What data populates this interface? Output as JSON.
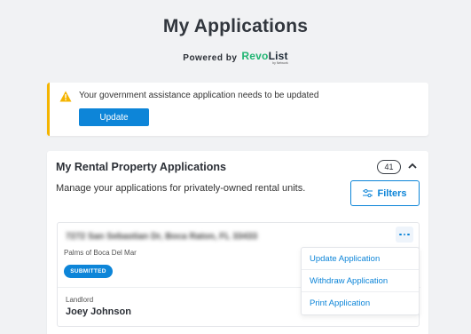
{
  "header": {
    "title": "My Applications",
    "powered_by": "Powered by",
    "logo": {
      "part1": "Revo",
      "part2": "List",
      "sub": "by Network"
    }
  },
  "alert": {
    "icon": "warning-icon",
    "message": "Your government assistance application needs to be updated",
    "button_label": "Update",
    "accent_color": "#f4b400"
  },
  "rental_applications": {
    "title": "My Rental Property Applications",
    "count": "41",
    "description": "Manage your applications for privately-owned rental units.",
    "filters_label": "Filters",
    "application": {
      "address": "7272 San Sebastian Dr, Boca Raton, FL 33433",
      "property_name": "Palms of Boca Del Mar",
      "status": "SUBMITTED",
      "landlord_label": "Landlord",
      "landlord_name": "Joey Johnson"
    },
    "menu": {
      "items": [
        "Update Application",
        "Withdraw Application",
        "Print Application"
      ]
    }
  },
  "colors": {
    "primary": "#0d85d8",
    "brand_green": "#21b573",
    "background": "#f1f2f4"
  }
}
